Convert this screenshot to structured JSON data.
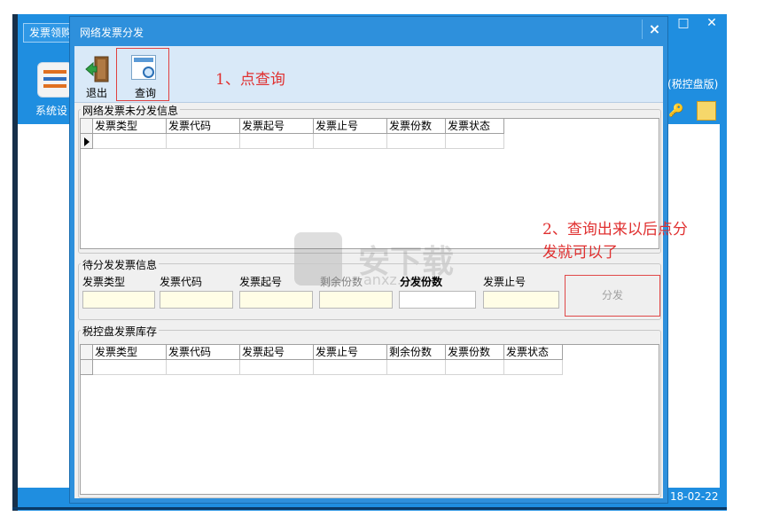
{
  "background_app": {
    "tab_label": "发票领购",
    "system_label": "系统设",
    "version_label": "(税控盘版)",
    "date_label": "18-02-22"
  },
  "dialog": {
    "title": "网络发票分发",
    "close_glyph": "×"
  },
  "toolbar": {
    "exit_label": "退出",
    "query_label": "查询"
  },
  "annotations": {
    "step1": "1、点查询",
    "step2_line1": "2、查询出来以后点分",
    "step2_line2": "发就可以了",
    "color": "#e03030"
  },
  "undistributed": {
    "title": "网络发票未分发信息",
    "columns": [
      "发票类型",
      "发票代码",
      "发票起号",
      "发票止号",
      "发票份数",
      "发票状态"
    ]
  },
  "pending": {
    "title": "待分发发票信息",
    "fields": {
      "type_label": "发票类型",
      "code_label": "发票代码",
      "start_label": "发票起号",
      "remaining_label": "剩余份数",
      "count_label": "分发份数",
      "end_label": "发票止号"
    },
    "distribute_button": "分发"
  },
  "stock": {
    "title": "税控盘发票库存",
    "columns": [
      "发票类型",
      "发票代码",
      "发票起号",
      "发票止号",
      "剩余份数",
      "发票份数",
      "发票状态"
    ]
  },
  "watermark": {
    "text": "安下载",
    "subtext": "anxz.com"
  }
}
